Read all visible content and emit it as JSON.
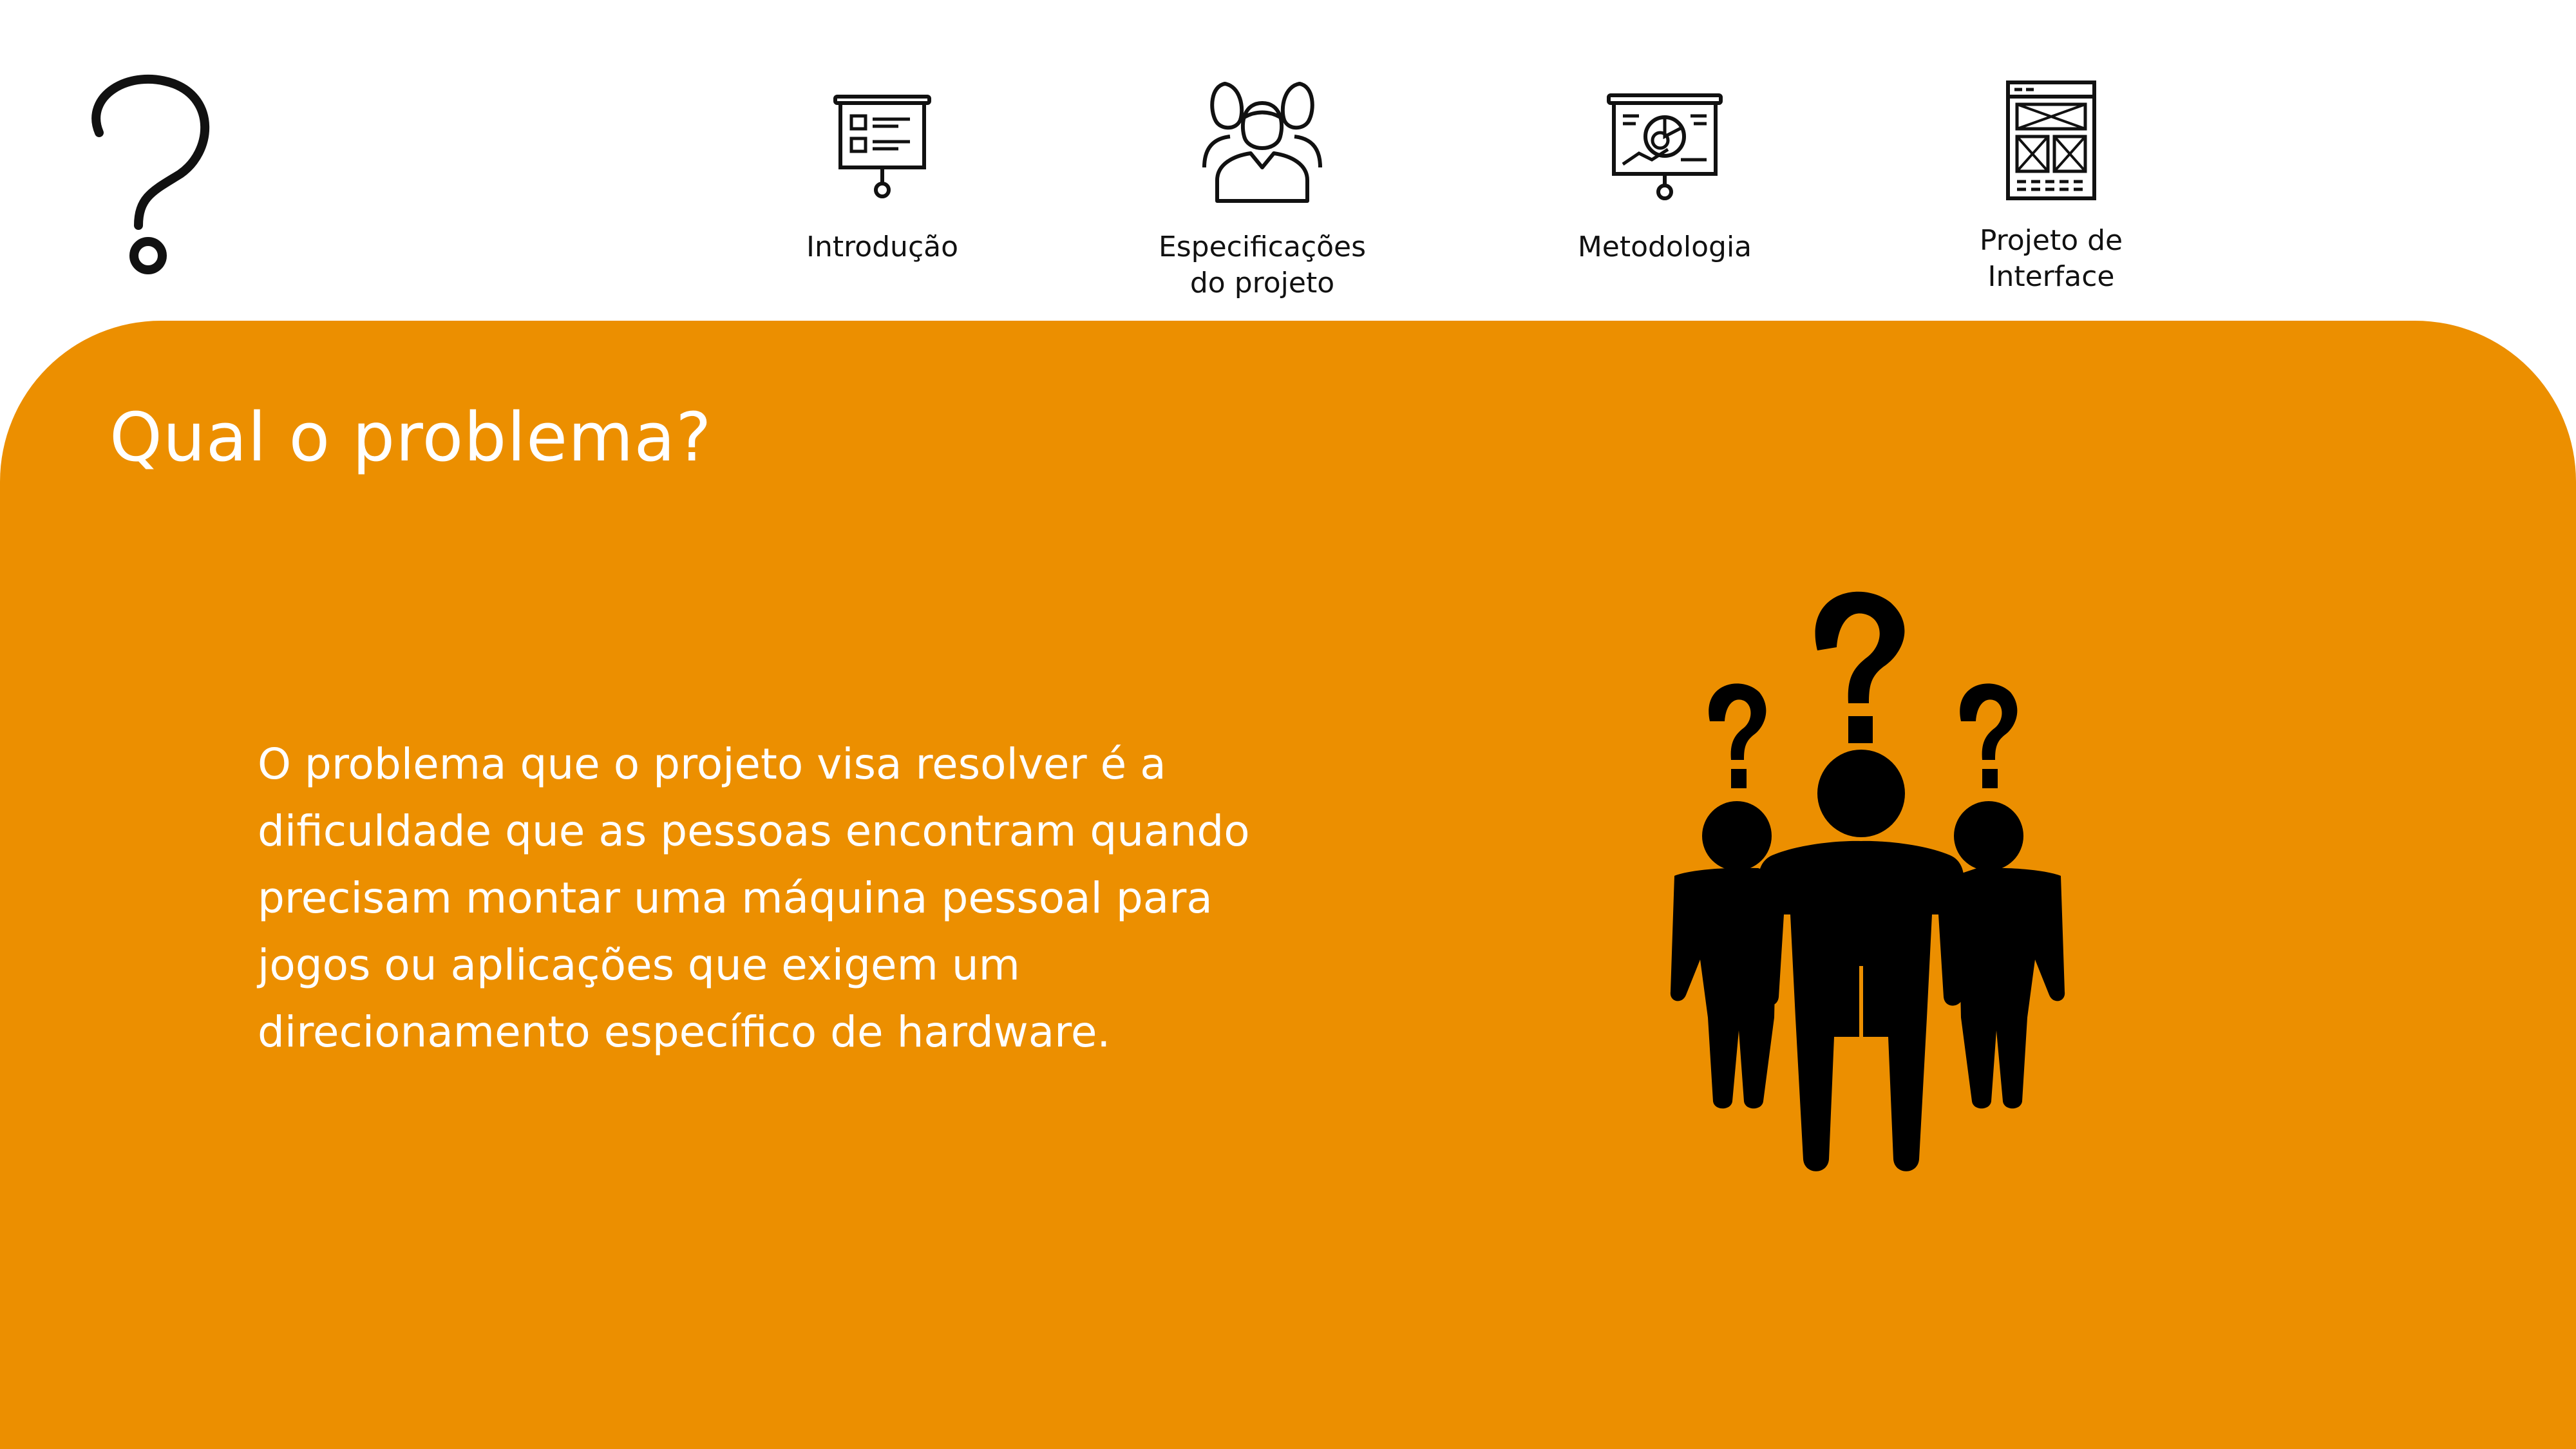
{
  "colors": {
    "accent": "#ec8f00",
    "nav_text": "#111111",
    "title_text": "#ffffff",
    "figure_fill": "#000000"
  },
  "header": {
    "logo_icon": "question-mark-icon",
    "nav": [
      {
        "label": "Introdução",
        "icon": "presentation-board-icon"
      },
      {
        "label": "Especificações\ndo projeto",
        "icon": "user-group-icon"
      },
      {
        "label": "Metodologia",
        "icon": "analytics-board-icon"
      },
      {
        "label": "Projeto de\nInterface",
        "icon": "wireframe-icon"
      }
    ]
  },
  "main": {
    "title": "Qual o problema?",
    "body": "O problema que o projeto visa resolver é a dificuldade que as pessoas encontram quando precisam montar uma máquina pessoal para jogos ou aplicações que exigem um direcionamento específico de hardware.",
    "illustration_icon": "confused-people-icon"
  }
}
